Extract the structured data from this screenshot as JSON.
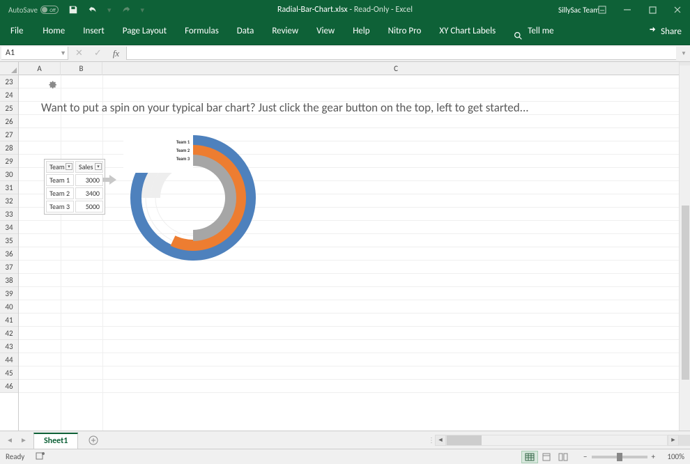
{
  "title": {
    "autosave_label": "AutoSave",
    "autosave_state": "Off",
    "filename": "Radial-Bar-Chart.xlsx",
    "readonly": "Read-Only",
    "appname": "Excel",
    "user": "SillySac Team"
  },
  "ribbon": {
    "tabs": [
      "File",
      "Home",
      "Insert",
      "Page Layout",
      "Formulas",
      "Data",
      "Review",
      "View",
      "Help",
      "Nitro Pro",
      "XY Chart Labels"
    ],
    "tellme": "Tell me",
    "share": "Share"
  },
  "fbar": {
    "namebox": "A1",
    "formula": ""
  },
  "rows": [
    "23",
    "24",
    "25",
    "26",
    "27",
    "28",
    "29",
    "30",
    "31",
    "32",
    "33",
    "34",
    "35",
    "36",
    "37",
    "38",
    "39",
    "40",
    "41",
    "42",
    "43",
    "44",
    "45",
    "46"
  ],
  "cols": [
    "A",
    "B",
    "C"
  ],
  "body": {
    "headline": "Want to put a spin on your typical bar chart? Just click the gear button on the top, left to get started...",
    "table": {
      "headers": [
        "Team",
        "Sales"
      ],
      "rows": [
        [
          "Team 1",
          "3000"
        ],
        [
          "Team 2",
          "3400"
        ],
        [
          "Team 3",
          "5000"
        ]
      ]
    },
    "legend": [
      "Team 1",
      "Team 2",
      "Team 3"
    ]
  },
  "sheettab": {
    "active": "Sheet1"
  },
  "status": {
    "ready": "Ready",
    "zoom": "100%",
    "minus": "−",
    "plus": "+"
  },
  "chart_data": {
    "type": "bar",
    "subtype": "radial",
    "categories": [
      "Team 1",
      "Team 2",
      "Team 3"
    ],
    "values": [
      3000,
      3400,
      5000
    ],
    "title": "",
    "xlabel": "",
    "ylabel": "",
    "colors": [
      "#a6a6a6",
      "#ed7d31",
      "#4e81bd"
    ]
  }
}
